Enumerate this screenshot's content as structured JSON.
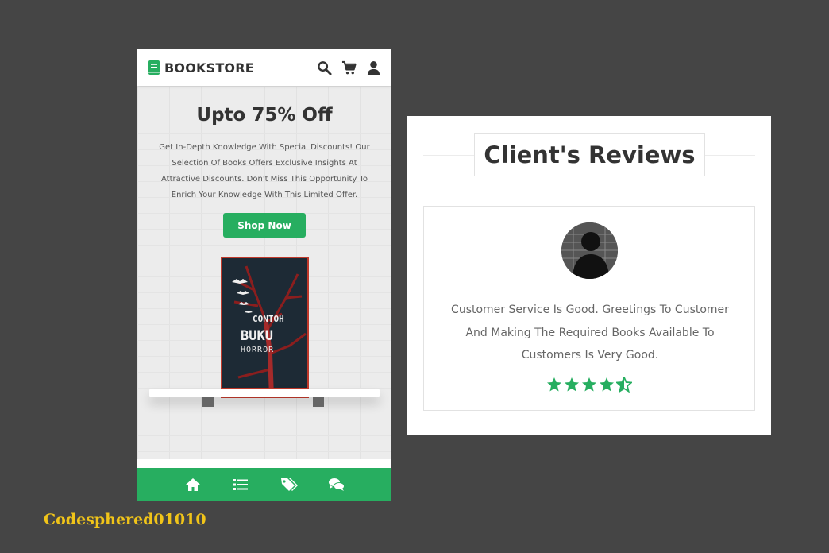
{
  "brand": {
    "name": "BOOKSTORE",
    "accent": "#27ae60"
  },
  "header_icons": [
    "search-icon",
    "cart-icon",
    "user-icon"
  ],
  "hero": {
    "title": "Upto 75% Off",
    "text": "Get In-Depth Knowledge With Special Discounts! Our Selection Of Books Offers Exclusive Insights At Attractive Discounts. Don't Miss This Opportunity To Enrich Your Knowledge With This Limited Offer.",
    "button": "Shop Now"
  },
  "book": {
    "line1": "CONTOH",
    "line2": "BUKU",
    "line3": "HORROR"
  },
  "bottom_nav": [
    "home-icon",
    "list-icon",
    "tags-icon",
    "comments-icon"
  ],
  "reviews": {
    "title": "Client's Reviews",
    "text": "Customer Service Is Good. Greetings To Customer And Making The Required Books Available To Customers Is Very Good.",
    "rating": 4.5,
    "max_rating": 5
  },
  "credit": "Codesphered01010"
}
